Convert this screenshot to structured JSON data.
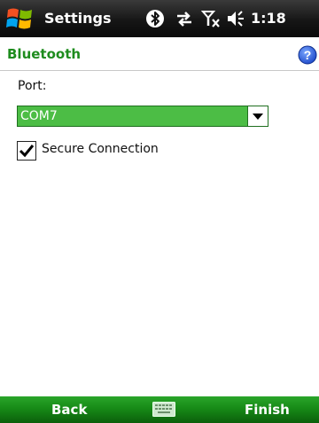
{
  "status_bar": {
    "app_title": "Settings",
    "time": "1:18",
    "icons": [
      "windows-start-icon",
      "bluetooth-icon",
      "connectivity-arrows-icon",
      "no-signal-icon",
      "speaker-icon"
    ]
  },
  "header": {
    "title": "Bluetooth",
    "help_icon": "help-icon"
  },
  "form": {
    "port_label": "Port:",
    "port_value": "COM7",
    "secure_connection_label": "Secure Connection",
    "secure_connection_checked": true
  },
  "menu_bar": {
    "left_softkey": "Back",
    "right_softkey": "Finish",
    "center_icon": "keyboard-icon"
  },
  "colors": {
    "accent_green": "#1e8c1e",
    "selected_combo": "#4cbd45",
    "menu_bar_green": "#178a17",
    "title_bar": "#161616"
  }
}
